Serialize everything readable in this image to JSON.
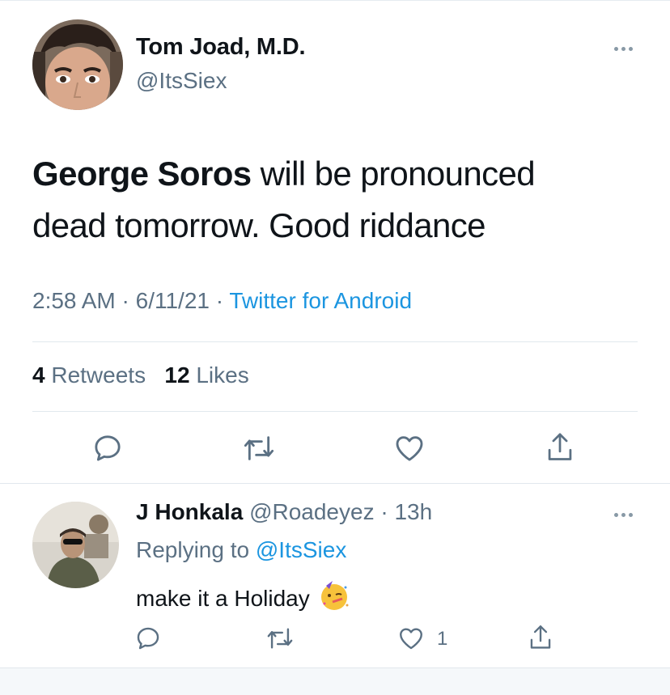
{
  "tweet": {
    "author_name": "Tom Joad, M.D.",
    "author_handle": "@ItsSiex",
    "text_bold": "George Soros",
    "text_rest_line1": " will be pronounced",
    "text_line2": "dead tomorrow. Good riddance",
    "time": "2:58 AM",
    "date": "6/11/21",
    "source": "Twitter for Android",
    "retweets_count": "4",
    "retweets_label": "Retweets",
    "likes_count": "12",
    "likes_label": "Likes",
    "icons": [
      "reply-icon",
      "retweet-icon",
      "like-icon",
      "share-icon",
      "more-icon"
    ]
  },
  "reply": {
    "author_name": "J Honkala",
    "author_handle": "@Roadeyez",
    "time_ago": "13h",
    "replying_label": "Replying to",
    "replying_to": "@ItsSiex",
    "text": "make it a Holiday",
    "emoji": "partying-face-emoji",
    "like_count": "1"
  },
  "colors": {
    "text": "#0f1419",
    "secondary": "#5b7083",
    "link": "#1b95e0",
    "divider": "#e1e8ed"
  }
}
